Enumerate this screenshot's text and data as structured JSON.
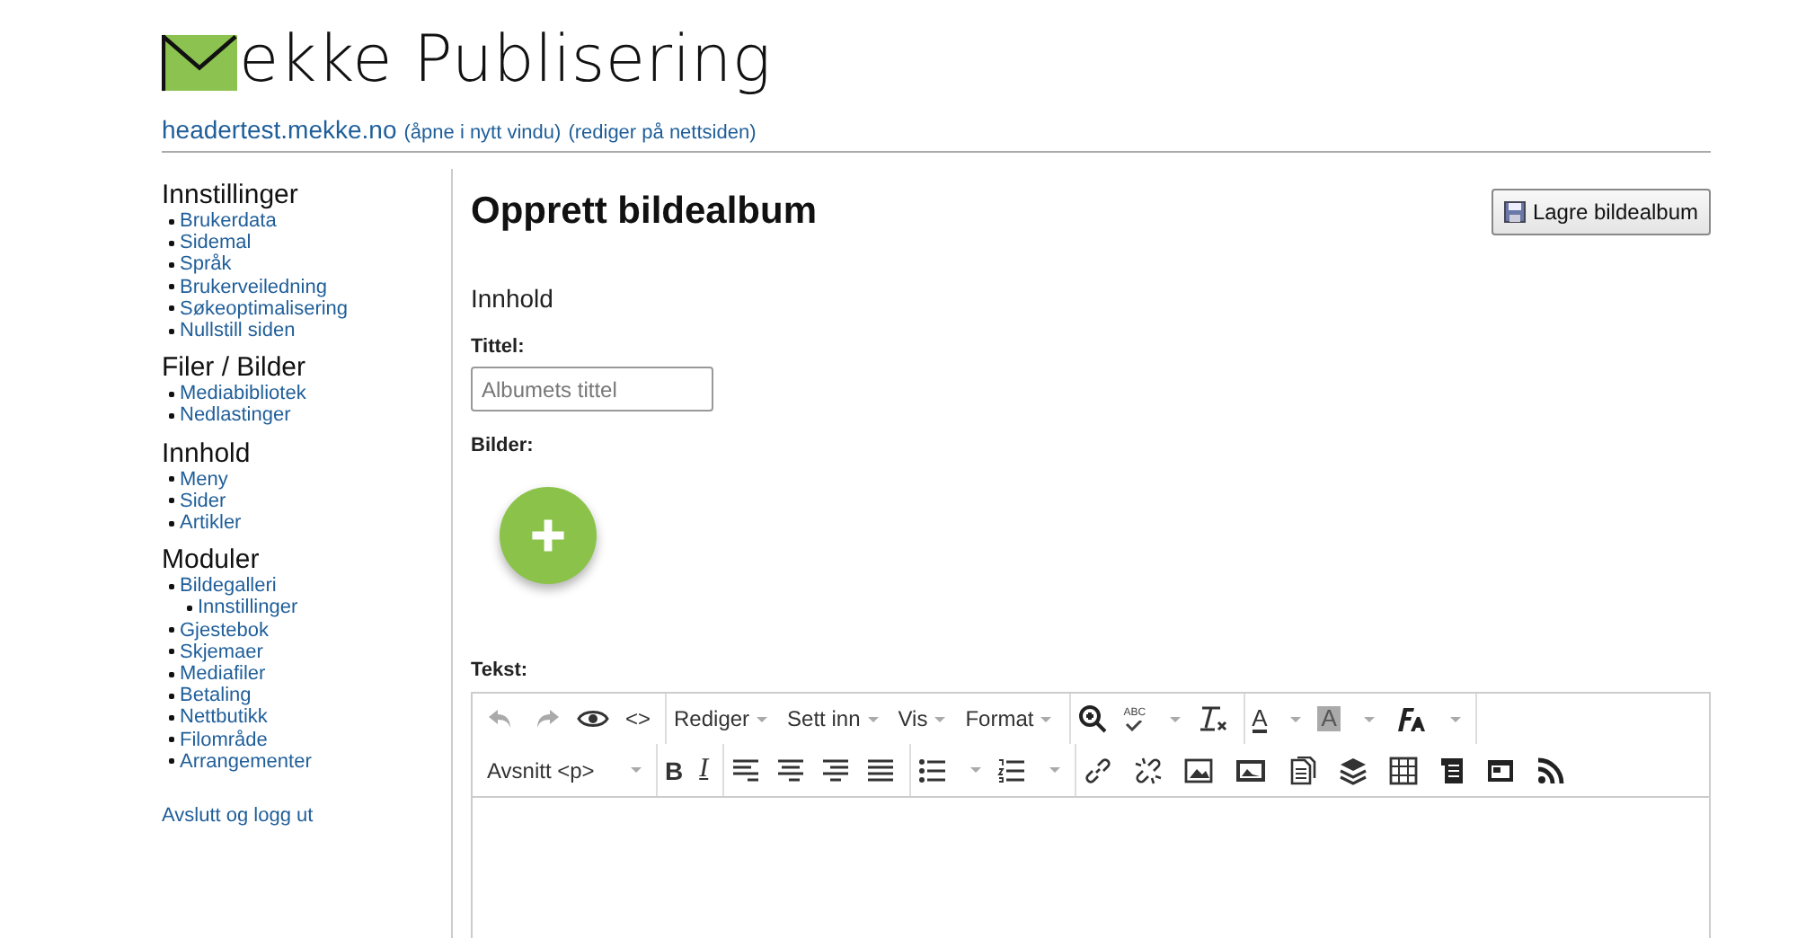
{
  "header": {
    "brand": "ekke Publisering",
    "site_link": "headertest.mekke.no",
    "links": [
      "(åpne i nytt vindu)",
      "(rediger på nettsiden)"
    ]
  },
  "sidebar": {
    "sections": [
      {
        "title": "Innstillinger",
        "items": [
          {
            "label": "Brukerdata"
          },
          {
            "label": "Sidemal"
          },
          {
            "label": "Språk"
          },
          {
            "label": "Brukerveiledning"
          },
          {
            "label": "Søkeoptimalisering"
          },
          {
            "label": "Nullstill siden"
          }
        ]
      },
      {
        "title": "Filer / Bilder",
        "items": [
          {
            "label": "Mediabibliotek"
          },
          {
            "label": "Nedlastinger"
          }
        ]
      },
      {
        "title": "Innhold",
        "items": [
          {
            "label": "Meny"
          },
          {
            "label": "Sider"
          },
          {
            "label": "Artikler"
          }
        ]
      },
      {
        "title": "Moduler",
        "items": [
          {
            "label": "Bildegalleri",
            "children": [
              {
                "label": "Innstillinger"
              }
            ]
          },
          {
            "label": "Gjestebok"
          },
          {
            "label": "Skjemaer"
          },
          {
            "label": "Mediafiler"
          },
          {
            "label": "Betaling"
          },
          {
            "label": "Nettbutikk"
          },
          {
            "label": "Filområde"
          },
          {
            "label": "Arrangementer"
          }
        ]
      }
    ],
    "logout": "Avslutt og logg ut"
  },
  "main": {
    "title": "Opprett bildealbum",
    "save_button": "Lagre bildealbum",
    "section": "Innhold",
    "title_label": "Tittel:",
    "title_placeholder": "Albumets tittel",
    "images_label": "Bilder:",
    "text_label": "Tekst:"
  },
  "editor": {
    "undo": {
      "disabled": true
    },
    "redo": {
      "disabled": true
    },
    "code_glyph": "<>",
    "menus": [
      "Rediger",
      "Sett inn",
      "Vis",
      "Format"
    ],
    "spell_glyph": "ABC",
    "text_color_glyph": "A",
    "bg_color_glyph": "A",
    "block_format": "Avsnitt <p>",
    "bold_glyph": "B",
    "italic_glyph": "I"
  }
}
